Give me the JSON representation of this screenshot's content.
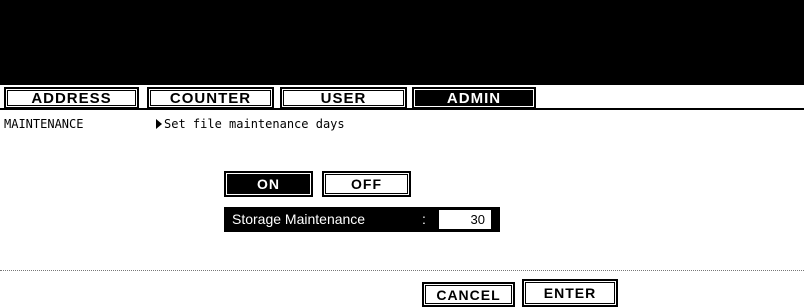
{
  "tabs": [
    {
      "label": "ADDRESS",
      "active": false
    },
    {
      "label": "COUNTER",
      "active": false
    },
    {
      "label": "USER",
      "active": false
    },
    {
      "label": "ADMIN",
      "active": true
    }
  ],
  "breadcrumb": {
    "section": "MAINTENANCE",
    "step": "Set file maintenance days"
  },
  "toggle": {
    "on_label": "ON",
    "off_label": "OFF",
    "selected": "ON"
  },
  "storage": {
    "label": "Storage Maintenance",
    "separator": ":",
    "value": "30"
  },
  "footer": {
    "cancel_label": "CANCEL",
    "enter_label": "ENTER"
  },
  "colors": {
    "background": "#ffffff",
    "foreground": "#000000"
  }
}
